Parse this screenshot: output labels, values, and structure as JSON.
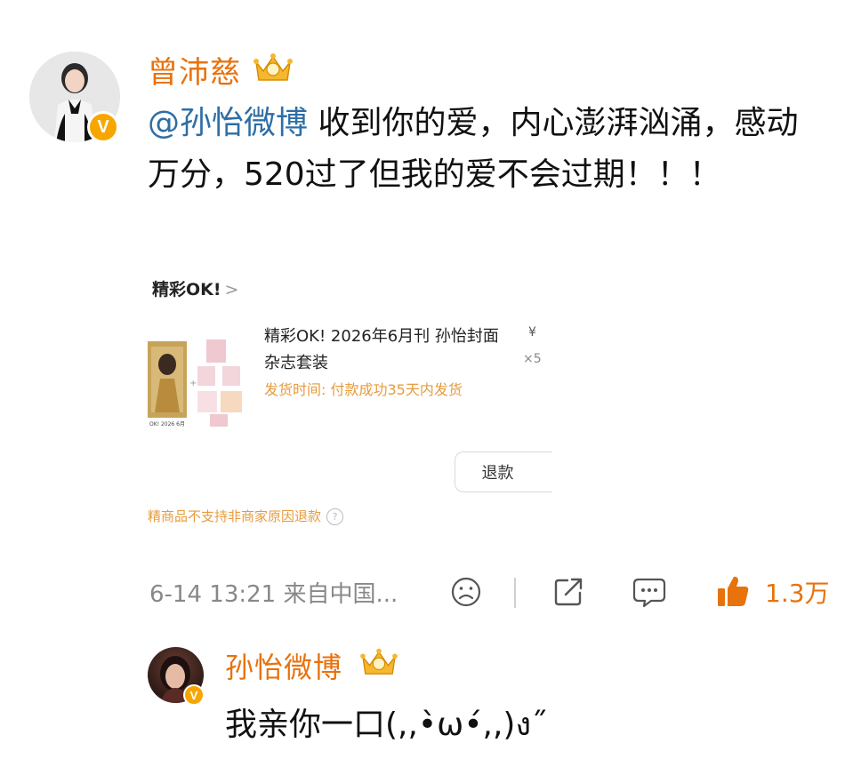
{
  "post": {
    "author": "曾沛慈",
    "mention": "@孙怡微博",
    "body": " 收到你的爱，内心澎湃汹涌，感动万分，520过了但我的爱不会过期！！！",
    "timestamp": "6-14 13:21",
    "source": "来自中国...",
    "like_count": "1.3万"
  },
  "card": {
    "shop_title": "精彩OK!",
    "chevron": ">",
    "product_name": "精彩OK! 2026年6月刊 孙怡封面杂志套装",
    "price": "¥",
    "quantity": "×5",
    "shipping": "发货时间: 付款成功35天内发货",
    "refund_button": "退款",
    "note": "精商品不支持非商家原因退款",
    "help_glyph": "?",
    "thumb_caption": "OK! 2026 6月"
  },
  "reply": {
    "author": "孙怡微博",
    "text": "我亲你一口(,,•̀ω•́,,)ง˝"
  },
  "icons": {
    "verified": "V",
    "crown": "crown-badge-icon",
    "dislike": "sad-face-icon",
    "share": "share-icon",
    "comment": "comment-icon",
    "like": "thumbs-up-icon"
  },
  "colors": {
    "accent_orange": "#e8720c",
    "mention_blue": "#2f6ea5",
    "verified_badge": "#f7a600",
    "shipping_text": "#e79b3d"
  }
}
